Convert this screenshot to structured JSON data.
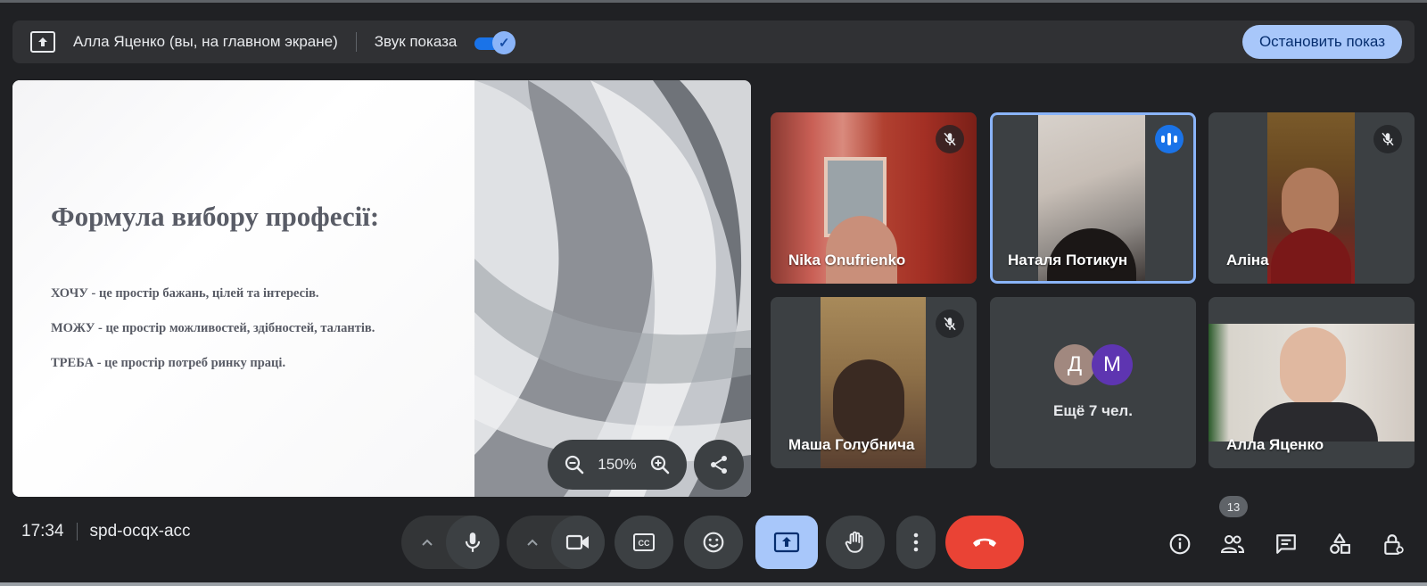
{
  "presenting_bar": {
    "presenter_text": "Алла Яценко (вы, на главном экране)",
    "sound_label": "Звук показа",
    "sound_enabled": true,
    "stop_button": "Остановить показ"
  },
  "slide": {
    "title": "Формула вибору професії:",
    "lines": [
      "ХОЧУ - це простір бажань, цілей та інтересів.",
      "МОЖУ -  це простір можливостей, здібностей, талантів.",
      "ТРЕБА -  це простір потреб ринку праці."
    ],
    "zoom_level": "150%"
  },
  "participants": [
    {
      "name": "Nika Onufrienko",
      "status": "muted"
    },
    {
      "name": "Наталя Потикун",
      "status": "speaking"
    },
    {
      "name": "Аліна",
      "status": "muted"
    },
    {
      "name": "Маша Голубнича",
      "status": "muted"
    },
    {
      "name": "Алла Яценко",
      "status": "self"
    }
  ],
  "more_tile": {
    "avatars": [
      {
        "letter": "Д",
        "color": "#a1887f"
      },
      {
        "letter": "М",
        "color": "#5e35b1"
      }
    ],
    "label": "Ещё 7 чел."
  },
  "meeting": {
    "time": "17:34",
    "code": "spd-ocqx-acc"
  },
  "controls": {
    "mic_icon": "mic-icon",
    "camera_icon": "camera-icon",
    "captions_icon": "closed-captions-icon",
    "emoji_icon": "emoji-icon",
    "present_icon": "present-screen-icon",
    "hand_icon": "raise-hand-icon",
    "more_icon": "more-options-icon",
    "end_call_icon": "end-call-icon",
    "end_call_color": "#ea4335",
    "present_active_color": "#a8c7fa"
  },
  "right_controls": {
    "participants_count": "13",
    "icons": [
      "info-icon",
      "people-icon",
      "chat-icon",
      "activities-icon",
      "host-controls-icon"
    ]
  }
}
